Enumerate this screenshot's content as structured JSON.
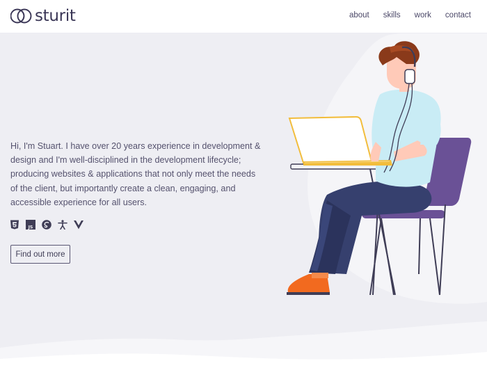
{
  "brand": {
    "name": "sturit",
    "logo_icon": "interlocking-circles-icon"
  },
  "nav": {
    "items": [
      {
        "label": "about"
      },
      {
        "label": "skills"
      },
      {
        "label": "work"
      },
      {
        "label": "contact"
      }
    ]
  },
  "hero": {
    "intro": "Hi, I'm Stuart. I have over 20 years experience in development & design and I'm well-disciplined in the development lifecycle; producing websites & applications that not only meet the needs of the client, but importantly create a clean, engaging, and accessible experience for all users.",
    "tech_icons": [
      "html5-icon",
      "javascript-icon",
      "css-icon",
      "accessibility-icon",
      "vue-icon"
    ],
    "cta_label": "Find out more"
  },
  "colors": {
    "background": "#eeeef3",
    "text": "#3f3d56",
    "accent_purple": "#6a5196",
    "laptop_yellow": "#f2bd3c",
    "shoe_orange": "#f26a1f",
    "shirt_blue": "#c9ecf5",
    "pants_navy": "#36406e"
  }
}
